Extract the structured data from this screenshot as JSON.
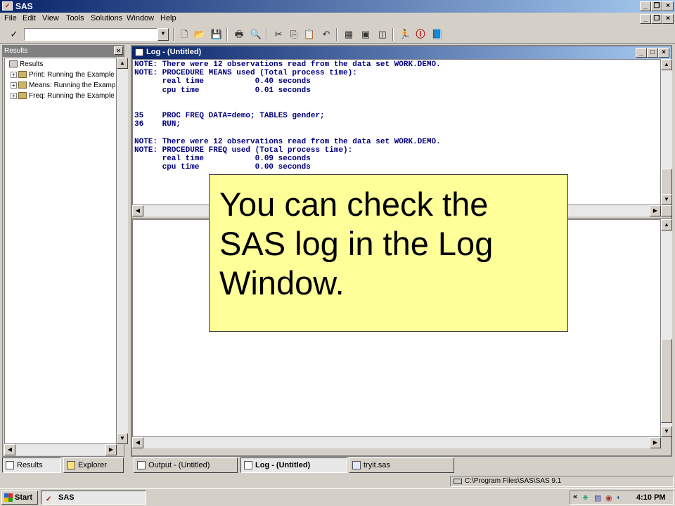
{
  "app": {
    "title": "SAS"
  },
  "menu": [
    "File",
    "Edit",
    "View",
    "Tools",
    "Solutions",
    "Window",
    "Help"
  ],
  "toolbar": {
    "command_value": ""
  },
  "results": {
    "title": "Results",
    "root": "Results",
    "items": [
      "Print:  Running the Example",
      "Means:  Running the Examp",
      "Freq:  Running the Example"
    ]
  },
  "log_window": {
    "title": "Log - (Untitled)",
    "text": "NOTE: There were 12 observations read from the data set WORK.DEMO.\nNOTE: PROCEDURE MEANS used (Total process time):\n      real time           0.40 seconds\n      cpu time            0.01 seconds\n\n\n35    PROC FREQ DATA=demo; TABLES gender;\n36    RUN;\n\nNOTE: There were 12 observations read from the data set WORK.DEMO.\nNOTE: PROCEDURE FREQ used (Total process time):\n      real time           0.09 seconds\n      cpu time            0.00 seconds"
  },
  "bottom_tabs": {
    "results_tab": "Results",
    "explorer_tab": "Explorer",
    "output_tab": "Output - (Untitled)",
    "log_tab": "Log - (Untitled)",
    "editor_tab": "tryit.sas"
  },
  "status_bar": {
    "path": "C:\\Program Files\\SAS\\SAS 9.1"
  },
  "taskbar": {
    "start": "Start",
    "task": "SAS",
    "clock": "4:10 PM"
  },
  "callout": {
    "text": "You can check the SAS log in the Log Window."
  },
  "colors": {
    "titlebar": "#0a246a",
    "log_text": "#000080",
    "callout_bg": "#ffff99"
  }
}
